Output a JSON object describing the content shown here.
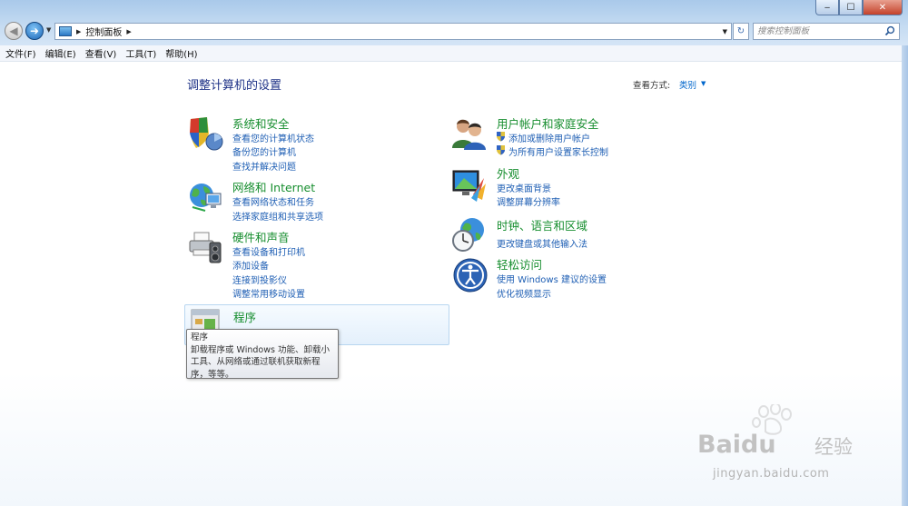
{
  "window": {
    "min_label": "‒",
    "max_label": "☐",
    "close_label": "✕"
  },
  "nav": {
    "back_glyph": "◀",
    "forward_glyph": "➜",
    "dropdown_glyph": "▼"
  },
  "address": {
    "sep_glyph": "▶",
    "path": "控制面板",
    "dropdown_glyph": "▼",
    "refresh_glyph": "↻"
  },
  "search": {
    "placeholder": "搜索控制面板"
  },
  "menu": {
    "items": [
      "文件(F)",
      "编辑(E)",
      "查看(V)",
      "工具(T)",
      "帮助(H)"
    ]
  },
  "page": {
    "title": "调整计算机的设置",
    "viewby_label": "查看方式:",
    "viewby_value": "类别",
    "viewby_dd": "▼"
  },
  "categories": {
    "system": {
      "title": "系统和安全",
      "links": [
        "查看您的计算机状态",
        "备份您的计算机",
        "查找并解决问题"
      ]
    },
    "network": {
      "title": "网络和 Internet",
      "links": [
        "查看网络状态和任务",
        "选择家庭组和共享选项"
      ]
    },
    "hardware": {
      "title": "硬件和声音",
      "links": [
        "查看设备和打印机",
        "添加设备",
        "连接到投影仪",
        "调整常用移动设置"
      ]
    },
    "programs": {
      "title": "程序"
    },
    "users": {
      "title": "用户帐户和家庭安全",
      "links": [
        "添加或删除用户帐户",
        "为所有用户设置家长控制"
      ]
    },
    "appearance": {
      "title": "外观",
      "links": [
        "更改桌面背景",
        "调整屏幕分辨率"
      ]
    },
    "clock": {
      "title": "时钟、语言和区域",
      "links": [
        "更改键盘或其他输入法"
      ]
    },
    "ease": {
      "title": "轻松访问",
      "links": [
        "使用 Windows 建议的设置",
        "优化视频显示"
      ]
    }
  },
  "tooltip": {
    "lines": [
      "程序",
      "卸载程序或 Windows 功能、卸载小",
      "工具、从网络或通过联机获取新程",
      "序，等等。"
    ]
  },
  "watermark": {
    "logo": "Baidu",
    "cn": "经验",
    "url": "jingyan.baidu.com"
  },
  "colors": {
    "category_title": "#178e2f",
    "link": "#1f5fb4",
    "page_title": "#1e3287"
  }
}
